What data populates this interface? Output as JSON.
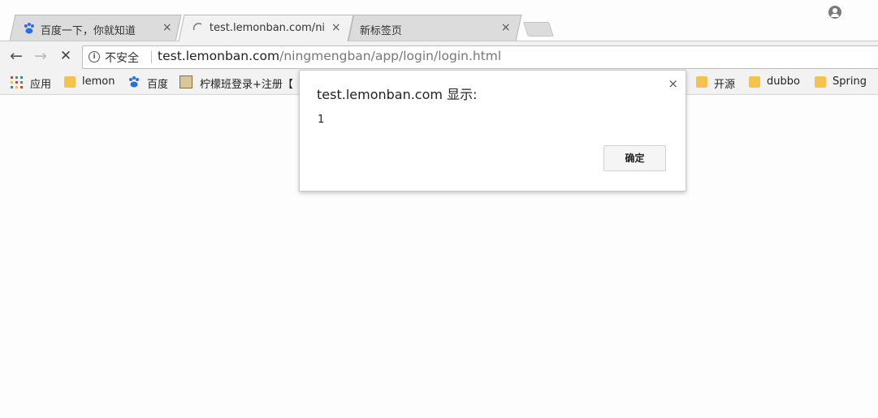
{
  "tabs": [
    {
      "title": "百度一下，你就知道",
      "close": "×"
    },
    {
      "title": "test.lemonban.com/nir",
      "close": "×"
    },
    {
      "title": "新标签页",
      "close": "×"
    }
  ],
  "toolbar": {
    "back": "←",
    "forward": "→",
    "stop": "✕",
    "security_label": "不安全",
    "url_host": "test.lemonban.com",
    "url_path": "/ningmengban/app/login/login.html"
  },
  "bookmarks": [
    {
      "label": "应用",
      "icon": "apps-grid-icon"
    },
    {
      "label": "lemon",
      "icon": "folder-icon"
    },
    {
      "label": "百度",
      "icon": "baidu-paw-icon"
    },
    {
      "label": "柠檬班登录+注册【",
      "icon": "image-icon"
    },
    {
      "label": "开源",
      "icon": "folder-icon"
    },
    {
      "label": "dubbo",
      "icon": "folder-icon"
    },
    {
      "label": "Spring",
      "icon": "folder-icon"
    }
  ],
  "dialog": {
    "title": "test.lemonban.com 显示:",
    "message": "1",
    "ok_label": "确定",
    "close": "×"
  },
  "colors": {
    "tab_inactive": "#dcdcdc",
    "toolbar_bg": "#f2f2f2",
    "folder": "#f4c24d",
    "baidu_blue": "#2b6de8"
  }
}
